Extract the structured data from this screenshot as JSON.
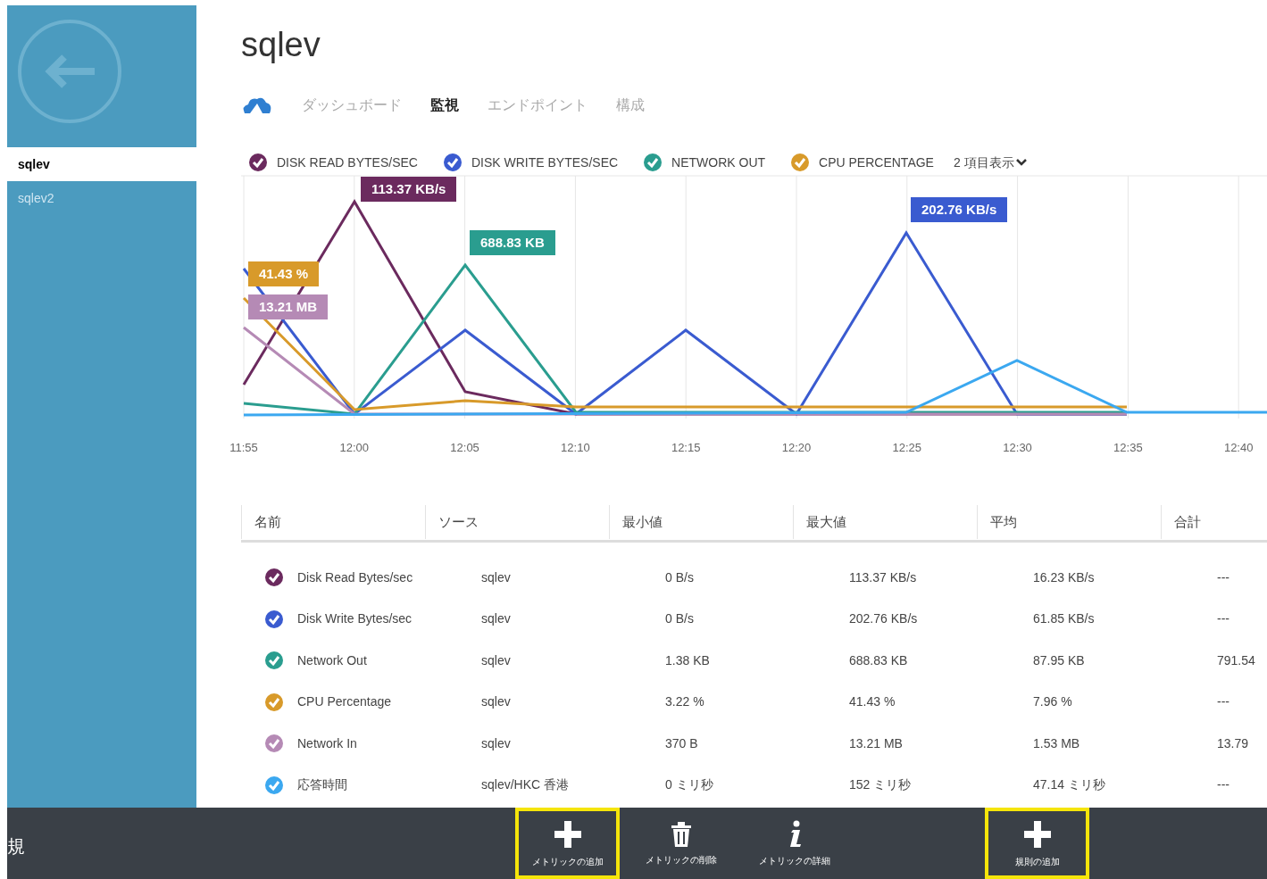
{
  "sidebar": {
    "items": [
      {
        "label": "sqlev",
        "selected": true
      },
      {
        "label": "sqlev2",
        "selected": false
      }
    ]
  },
  "title": "sqlev",
  "tabs": [
    {
      "label": "ダッシュボード",
      "selected": false
    },
    {
      "label": "監視",
      "selected": true
    },
    {
      "label": "エンドポイント",
      "selected": false
    },
    {
      "label": "構成",
      "selected": false
    }
  ],
  "legend": {
    "items": [
      {
        "label": "DISK READ BYTES/SEC",
        "color": "#6b2a5e"
      },
      {
        "label": "DISK WRITE BYTES/SEC",
        "color": "#3a5bd0"
      },
      {
        "label": "NETWORK OUT",
        "color": "#2a9d8f"
      },
      {
        "label": "CPU PERCENTAGE",
        "color": "#d89a2a"
      }
    ],
    "more": "2 項目表示"
  },
  "chart": {
    "x_labels": [
      "11:55",
      "12:00",
      "12:05",
      "12:10",
      "12:15",
      "12:20",
      "12:25",
      "12:30",
      "12:35",
      "12:40"
    ],
    "callouts": [
      {
        "text": "113.37 KB/s",
        "color": "#6b2a5e"
      },
      {
        "text": "688.83 KB",
        "color": "#2a9d8f"
      },
      {
        "text": "202.76 KB/s",
        "color": "#3a5bd0"
      },
      {
        "text": "41.43 %",
        "color": "#d89a2a"
      },
      {
        "text": "13.21 MB",
        "color": "#b58ab5"
      }
    ]
  },
  "table": {
    "columns": [
      "名前",
      "ソース",
      "最小値",
      "最大値",
      "平均",
      "合計"
    ],
    "rows": [
      {
        "color": "#6b2a5e",
        "cells": [
          "Disk Read Bytes/sec",
          "sqlev",
          "0 B/s",
          "113.37 KB/s",
          "16.23 KB/s",
          "---"
        ]
      },
      {
        "color": "#3a5bd0",
        "cells": [
          "Disk Write Bytes/sec",
          "sqlev",
          "0 B/s",
          "202.76 KB/s",
          "61.85 KB/s",
          "---"
        ]
      },
      {
        "color": "#2a9d8f",
        "cells": [
          "Network Out",
          "sqlev",
          "1.38 KB",
          "688.83 KB",
          "87.95 KB",
          "791.54"
        ]
      },
      {
        "color": "#d89a2a",
        "cells": [
          "CPU Percentage",
          "sqlev",
          "3.22 %",
          "41.43 %",
          "7.96 %",
          "---"
        ]
      },
      {
        "color": "#b58ab5",
        "cells": [
          "Network In",
          "sqlev",
          "370 B",
          "13.21 MB",
          "1.53 MB",
          "13.79"
        ]
      },
      {
        "color": "#3ba8f0",
        "cells": [
          "応答時間",
          "sqlev/HKC 香港",
          "0 ミリ秒",
          "152 ミリ秒",
          "47.14 ミリ秒",
          "---"
        ]
      }
    ]
  },
  "command_bar": {
    "left_text": "規",
    "buttons": [
      {
        "kind": "add",
        "label": "メトリックの追加",
        "highlighted": true
      },
      {
        "kind": "delete",
        "label": "メトリックの削除",
        "highlighted": false
      },
      {
        "kind": "info",
        "label": "メトリックの詳細",
        "highlighted": false
      },
      {
        "kind": "add",
        "label": "規則の追加",
        "highlighted": true
      }
    ]
  }
}
